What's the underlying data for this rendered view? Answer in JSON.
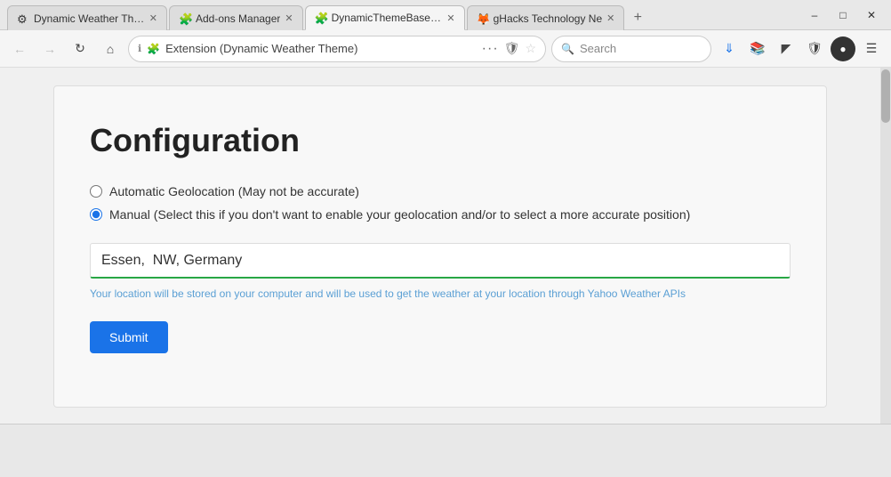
{
  "window": {
    "title": "Dynamic Weather Theme"
  },
  "tabs": [
    {
      "id": "tab1",
      "icon": "⚙",
      "icon_color": "#4a9eff",
      "label": "Dynamic Weather Them",
      "active": false
    },
    {
      "id": "tab2",
      "icon": "🧩",
      "icon_color": "#555",
      "label": "Add-ons Manager",
      "active": false
    },
    {
      "id": "tab3",
      "icon": "🧩",
      "icon_color": "#555",
      "label": "DynamicThemeBasedOnWe",
      "active": true
    },
    {
      "id": "tab4",
      "icon": "🦊",
      "icon_color": "#e8612e",
      "label": "gHacks Technology Ne",
      "active": false
    }
  ],
  "nav": {
    "back_disabled": true,
    "forward_disabled": true,
    "address": "Extension (Dynamic Weather Theme)",
    "search_placeholder": "Search"
  },
  "config": {
    "title": "Configuration",
    "radio_options": [
      {
        "id": "auto",
        "label": "Automatic Geolocation (May not be accurate)",
        "checked": false
      },
      {
        "id": "manual",
        "label": "Manual (Select this if you don't want to enable your geolocation and/or to select a more accurate position)",
        "checked": true
      }
    ],
    "location_value": "Essen,  NW, Germany",
    "hint": "Your location will be stored on your computer and will be used to get the weather at your location through Yahoo Weather APIs",
    "submit_label": "Submit"
  }
}
